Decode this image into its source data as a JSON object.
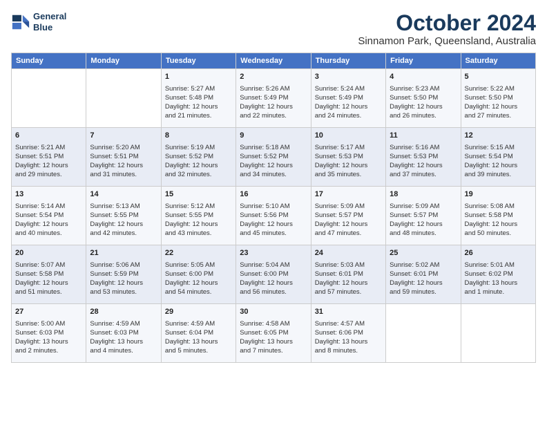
{
  "logo": {
    "line1": "General",
    "line2": "Blue"
  },
  "title": "October 2024",
  "location": "Sinnamon Park, Queensland, Australia",
  "headers": [
    "Sunday",
    "Monday",
    "Tuesday",
    "Wednesday",
    "Thursday",
    "Friday",
    "Saturday"
  ],
  "weeks": [
    [
      {
        "day": "",
        "detail": ""
      },
      {
        "day": "",
        "detail": ""
      },
      {
        "day": "1",
        "detail": "Sunrise: 5:27 AM\nSunset: 5:48 PM\nDaylight: 12 hours\nand 21 minutes."
      },
      {
        "day": "2",
        "detail": "Sunrise: 5:26 AM\nSunset: 5:49 PM\nDaylight: 12 hours\nand 22 minutes."
      },
      {
        "day": "3",
        "detail": "Sunrise: 5:24 AM\nSunset: 5:49 PM\nDaylight: 12 hours\nand 24 minutes."
      },
      {
        "day": "4",
        "detail": "Sunrise: 5:23 AM\nSunset: 5:50 PM\nDaylight: 12 hours\nand 26 minutes."
      },
      {
        "day": "5",
        "detail": "Sunrise: 5:22 AM\nSunset: 5:50 PM\nDaylight: 12 hours\nand 27 minutes."
      }
    ],
    [
      {
        "day": "6",
        "detail": "Sunrise: 5:21 AM\nSunset: 5:51 PM\nDaylight: 12 hours\nand 29 minutes."
      },
      {
        "day": "7",
        "detail": "Sunrise: 5:20 AM\nSunset: 5:51 PM\nDaylight: 12 hours\nand 31 minutes."
      },
      {
        "day": "8",
        "detail": "Sunrise: 5:19 AM\nSunset: 5:52 PM\nDaylight: 12 hours\nand 32 minutes."
      },
      {
        "day": "9",
        "detail": "Sunrise: 5:18 AM\nSunset: 5:52 PM\nDaylight: 12 hours\nand 34 minutes."
      },
      {
        "day": "10",
        "detail": "Sunrise: 5:17 AM\nSunset: 5:53 PM\nDaylight: 12 hours\nand 35 minutes."
      },
      {
        "day": "11",
        "detail": "Sunrise: 5:16 AM\nSunset: 5:53 PM\nDaylight: 12 hours\nand 37 minutes."
      },
      {
        "day": "12",
        "detail": "Sunrise: 5:15 AM\nSunset: 5:54 PM\nDaylight: 12 hours\nand 39 minutes."
      }
    ],
    [
      {
        "day": "13",
        "detail": "Sunrise: 5:14 AM\nSunset: 5:54 PM\nDaylight: 12 hours\nand 40 minutes."
      },
      {
        "day": "14",
        "detail": "Sunrise: 5:13 AM\nSunset: 5:55 PM\nDaylight: 12 hours\nand 42 minutes."
      },
      {
        "day": "15",
        "detail": "Sunrise: 5:12 AM\nSunset: 5:55 PM\nDaylight: 12 hours\nand 43 minutes."
      },
      {
        "day": "16",
        "detail": "Sunrise: 5:10 AM\nSunset: 5:56 PM\nDaylight: 12 hours\nand 45 minutes."
      },
      {
        "day": "17",
        "detail": "Sunrise: 5:09 AM\nSunset: 5:57 PM\nDaylight: 12 hours\nand 47 minutes."
      },
      {
        "day": "18",
        "detail": "Sunrise: 5:09 AM\nSunset: 5:57 PM\nDaylight: 12 hours\nand 48 minutes."
      },
      {
        "day": "19",
        "detail": "Sunrise: 5:08 AM\nSunset: 5:58 PM\nDaylight: 12 hours\nand 50 minutes."
      }
    ],
    [
      {
        "day": "20",
        "detail": "Sunrise: 5:07 AM\nSunset: 5:58 PM\nDaylight: 12 hours\nand 51 minutes."
      },
      {
        "day": "21",
        "detail": "Sunrise: 5:06 AM\nSunset: 5:59 PM\nDaylight: 12 hours\nand 53 minutes."
      },
      {
        "day": "22",
        "detail": "Sunrise: 5:05 AM\nSunset: 6:00 PM\nDaylight: 12 hours\nand 54 minutes."
      },
      {
        "day": "23",
        "detail": "Sunrise: 5:04 AM\nSunset: 6:00 PM\nDaylight: 12 hours\nand 56 minutes."
      },
      {
        "day": "24",
        "detail": "Sunrise: 5:03 AM\nSunset: 6:01 PM\nDaylight: 12 hours\nand 57 minutes."
      },
      {
        "day": "25",
        "detail": "Sunrise: 5:02 AM\nSunset: 6:01 PM\nDaylight: 12 hours\nand 59 minutes."
      },
      {
        "day": "26",
        "detail": "Sunrise: 5:01 AM\nSunset: 6:02 PM\nDaylight: 13 hours\nand 1 minute."
      }
    ],
    [
      {
        "day": "27",
        "detail": "Sunrise: 5:00 AM\nSunset: 6:03 PM\nDaylight: 13 hours\nand 2 minutes."
      },
      {
        "day": "28",
        "detail": "Sunrise: 4:59 AM\nSunset: 6:03 PM\nDaylight: 13 hours\nand 4 minutes."
      },
      {
        "day": "29",
        "detail": "Sunrise: 4:59 AM\nSunset: 6:04 PM\nDaylight: 13 hours\nand 5 minutes."
      },
      {
        "day": "30",
        "detail": "Sunrise: 4:58 AM\nSunset: 6:05 PM\nDaylight: 13 hours\nand 7 minutes."
      },
      {
        "day": "31",
        "detail": "Sunrise: 4:57 AM\nSunset: 6:06 PM\nDaylight: 13 hours\nand 8 minutes."
      },
      {
        "day": "",
        "detail": ""
      },
      {
        "day": "",
        "detail": ""
      }
    ]
  ]
}
